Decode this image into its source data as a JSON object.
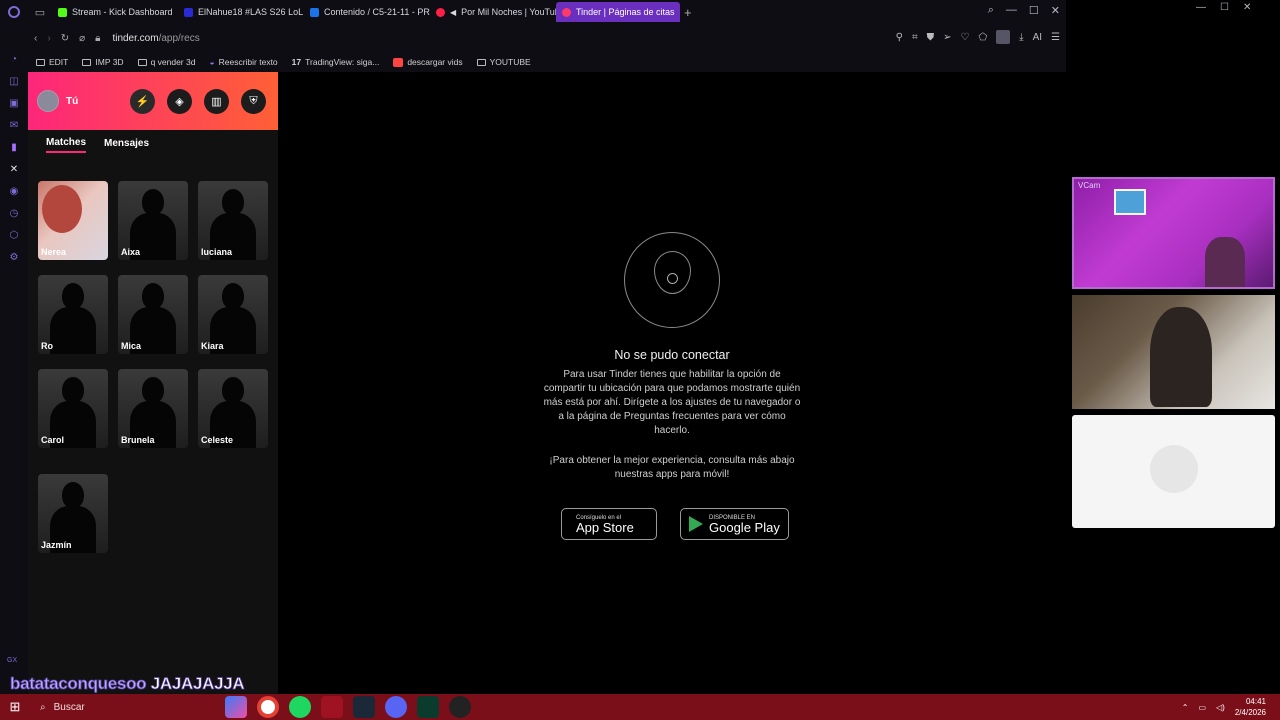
{
  "browser": {
    "tabs": [
      {
        "label": "Stream - Kick Dashboard",
        "color": "#53fc18"
      },
      {
        "label": "ElNahue18 #LAS S26 LoL",
        "color": "#2b2bd6"
      },
      {
        "label": "Contenido / C5-21-11 - PR",
        "color": "#1a73e8"
      },
      {
        "label": "Por Mil Noches | YouTube",
        "color": "#ff1f47"
      },
      {
        "label": "Tinder | Páginas de citas",
        "color": "#fd3a6a"
      }
    ],
    "url_host": "tinder.com",
    "url_path": "/app/recs",
    "ai_label": "AI",
    "bookmarks": [
      {
        "label": "EDIT",
        "type": "folder"
      },
      {
        "label": "IMP 3D",
        "type": "folder"
      },
      {
        "label": "q vender 3d",
        "type": "folder"
      },
      {
        "label": "Reescribir texto",
        "type": "link"
      },
      {
        "label": "TradingView: siga...",
        "type": "link"
      },
      {
        "label": "descargar vids",
        "type": "link"
      },
      {
        "label": "YOUTUBE",
        "type": "folder"
      }
    ]
  },
  "tinder": {
    "profile_name": "Tú",
    "tabs": {
      "matches": "Matches",
      "messages": "Mensajes"
    },
    "matches": [
      {
        "name": "Nerea",
        "photo": true
      },
      {
        "name": "Aixa",
        "photo": false
      },
      {
        "name": "luciana",
        "photo": false
      },
      {
        "name": "Ro",
        "photo": false
      },
      {
        "name": "Mica",
        "photo": false
      },
      {
        "name": "Kiara",
        "photo": false
      },
      {
        "name": "Carol",
        "photo": false
      },
      {
        "name": "Brunela",
        "photo": false
      },
      {
        "name": "Celeste",
        "photo": false
      },
      {
        "name": "Jazmín",
        "photo": false
      }
    ],
    "error_title": "No se pudo conectar",
    "error_body": "Para usar Tinder tienes que habilitar la opción de compartir tu ubicación para que podamos mostrarte quién más está por ahí. Dirígete a los ajustes de tu navegador o a la página de Preguntas frecuentes para ver cómo hacerlo.",
    "error_body2": "¡Para obtener la mejor experiencia, consulta más abajo nuestras apps para móvil!",
    "appstore_small": "Consíguelo en el",
    "appstore_big": "App Store",
    "gplay_small": "DISPONIBLE EN",
    "gplay_big": "Google Play"
  },
  "stream": {
    "cam_label": "VCam",
    "overlay_user": "batataconquesoo",
    "overlay_msg": "JAJAJAJJA"
  },
  "taskbar": {
    "search_placeholder": "Buscar",
    "time": "04:41",
    "date": "2/4/2026"
  }
}
